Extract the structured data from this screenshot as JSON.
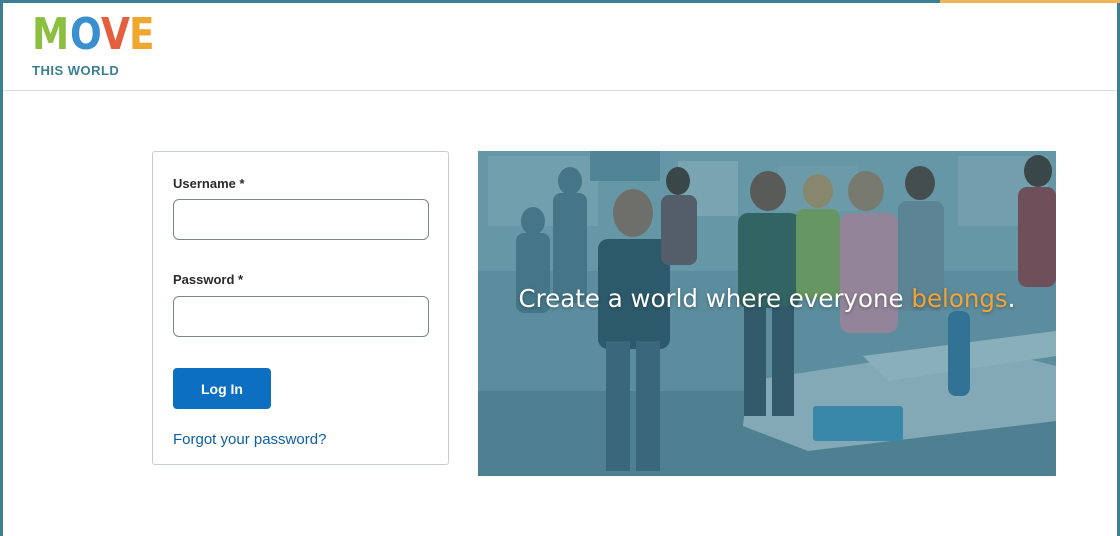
{
  "brand": {
    "logo_main": [
      "M",
      "O",
      "V",
      "E"
    ],
    "logo_sub": "THIS WORLD",
    "colors": {
      "m": "#8bbf3f",
      "o": "#3a8fcf",
      "v": "#e65f3c",
      "e": "#f0a72f",
      "frame": "#3a7f93"
    }
  },
  "login": {
    "username_label": "Username *",
    "username_value": "",
    "password_label": "Password *",
    "password_value": "",
    "submit_label": "Log In",
    "forgot_label": "Forgot your password?"
  },
  "hero": {
    "tagline_prefix": "Create a world where everyone ",
    "tagline_accent": "belongs",
    "tagline_suffix": ".",
    "accent_color": "#f3a338"
  }
}
